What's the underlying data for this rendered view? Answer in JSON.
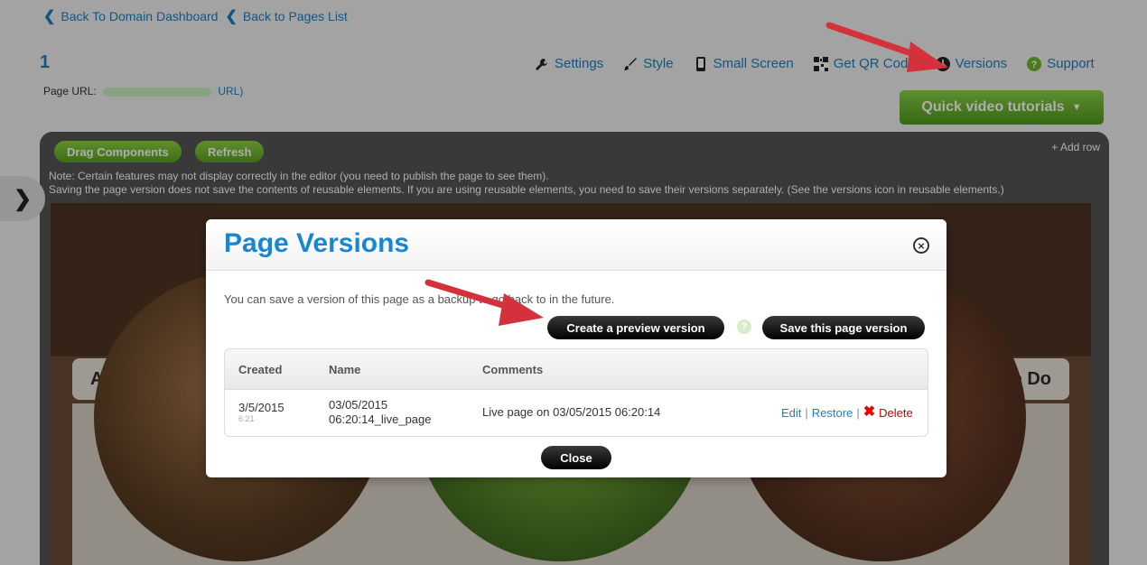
{
  "nav": {
    "back_domain": "Back To Domain Dashboard",
    "back_pages": "Back to Pages List"
  },
  "page": {
    "id": "1",
    "url_label": "Page URL:",
    "url_suffix": "URL)"
  },
  "toolbar": {
    "settings": "Settings",
    "style": "Style",
    "small_screen": "Small Screen",
    "qr": "Get QR Code",
    "versions": "Versions",
    "support": "Support"
  },
  "quick_video": "Quick video tutorials",
  "editor": {
    "drag": "Drag Components",
    "refresh": "Refresh",
    "add_row": "+ Add row",
    "note1": "Note: Certain features may not display correctly in the editor (you need to publish the page to see them).",
    "note2": "Saving the page version does not save the contents of reusable elements. If you are using reusable elements, you need to save their versions separately. (See the versions icon in reusable elements.)",
    "nav_left": "About",
    "nav_right": "We Do"
  },
  "modal": {
    "title": "Page Versions",
    "desc": "You can save a version of this page as a backup to go back to in the future.",
    "create_preview": "Create a preview version",
    "help": "?",
    "save_version": "Save this page version",
    "close": "Close",
    "columns": [
      "Created",
      "Name",
      "Comments"
    ],
    "rows": [
      {
        "created": "3/5/2015",
        "created_time": "6:21",
        "name_line1": "03/05/2015",
        "name_line2": "06:20:14_live_page",
        "comments": "Live page on 03/05/2015 06:20:14",
        "edit": "Edit",
        "restore": "Restore",
        "delete": "Delete"
      }
    ]
  },
  "colors": {
    "link_blue": "#1f7fbf",
    "title_blue": "#1a86cf",
    "green": "#6db52a",
    "arrow_red": "#d3323c"
  }
}
